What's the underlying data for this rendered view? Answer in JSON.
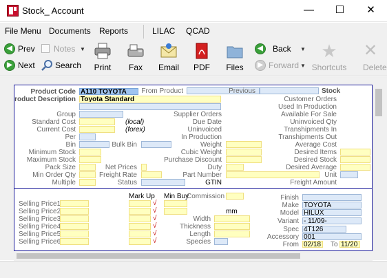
{
  "window": {
    "title": "Stock_ Account",
    "minimize": "—",
    "maximize": "☐",
    "close": "✕"
  },
  "menu": [
    "File Menu",
    "Documents",
    "Reports",
    "LILAC",
    "QCAD"
  ],
  "toolbar": {
    "prev": "Prev",
    "next": "Next",
    "notes": "Notes",
    "search": "Search",
    "print": "Print",
    "fax": "Fax",
    "email": "Email",
    "pdf": "PDF",
    "files": "Files",
    "back": "Back",
    "forward": "Forward",
    "shortcuts": "Shortcuts",
    "delete": "Delete"
  },
  "form": {
    "labels": {
      "product_code": "Product Code",
      "product_description": "Product Description",
      "group": "Group",
      "standard_cost": "Standard Cost",
      "current_cost": "Current Cost",
      "per": "Per",
      "bin": "Bin",
      "bulk_bin": "Bulk Bin",
      "minimum_stock": "Minimum Stock",
      "maximum_stock": "Maximum Stock",
      "pack_size": "Pack Size",
      "net_prices": "Net Prices",
      "min_order_qty": "Min Order Qty",
      "freight_rate": "Freight Rate",
      "multiple": "Multiple",
      "status": "Status",
      "gtin": "GTIN",
      "local": "(local)",
      "forex": "(forex)",
      "from_product": "From Product",
      "previous": "Previous",
      "stock": "Stock",
      "supplier_orders": "Supplier Orders",
      "due_date": "Due Date",
      "uninvoiced": "Uninvoiced",
      "in_production": "In Production",
      "weight": "Weight",
      "cubic_weight": "Cubic Weight",
      "purchase_discount": "Purchase Discount",
      "duty": "Duty",
      "part_number": "Part Number",
      "customer_orders": "Customer Orders",
      "used_in_production": "Used In Production",
      "available_for_sale": "Available For Sale",
      "uninvoiced_qty": "Uninvoiced Qty",
      "transhipments_in": "Transhipments In",
      "transhipments_out": "Transhipments Out",
      "average_cost": "Average Cost",
      "desired_items": "Desired Items",
      "desired_stock": "Desired Stock",
      "desired_average": "Desired Average",
      "unit": "Unit",
      "freight_amount": "Freight Amount"
    },
    "values": {
      "product_code": "A110 TOYOTA",
      "product_description": "Toyota Standard"
    }
  },
  "pricing": {
    "selling_prices": [
      "Selling Price1",
      "Selling Price2",
      "Selling Price3",
      "Selling Price4",
      "Selling Price5",
      "Selling Price6"
    ],
    "mark_up": "Mark Up",
    "min_buy": "Min Buy",
    "commission": "Commission",
    "tick": "√",
    "mm": "mm",
    "width": "Width",
    "thickness": "Thickness",
    "length": "Length",
    "species": "Species"
  },
  "vehicle": {
    "labels": {
      "finish": "Finish",
      "make": "Make",
      "model": "Model",
      "variant": "Variant",
      "spec": "Spec",
      "accessory": "Accessory",
      "from": "From",
      "to": "To"
    },
    "values": {
      "make": "TOYOTA",
      "model": "HILUX",
      "variant": "-        11/09-",
      "spec": "4T126",
      "accessory": "001",
      "from": "02/18",
      "to": "11/20"
    }
  }
}
